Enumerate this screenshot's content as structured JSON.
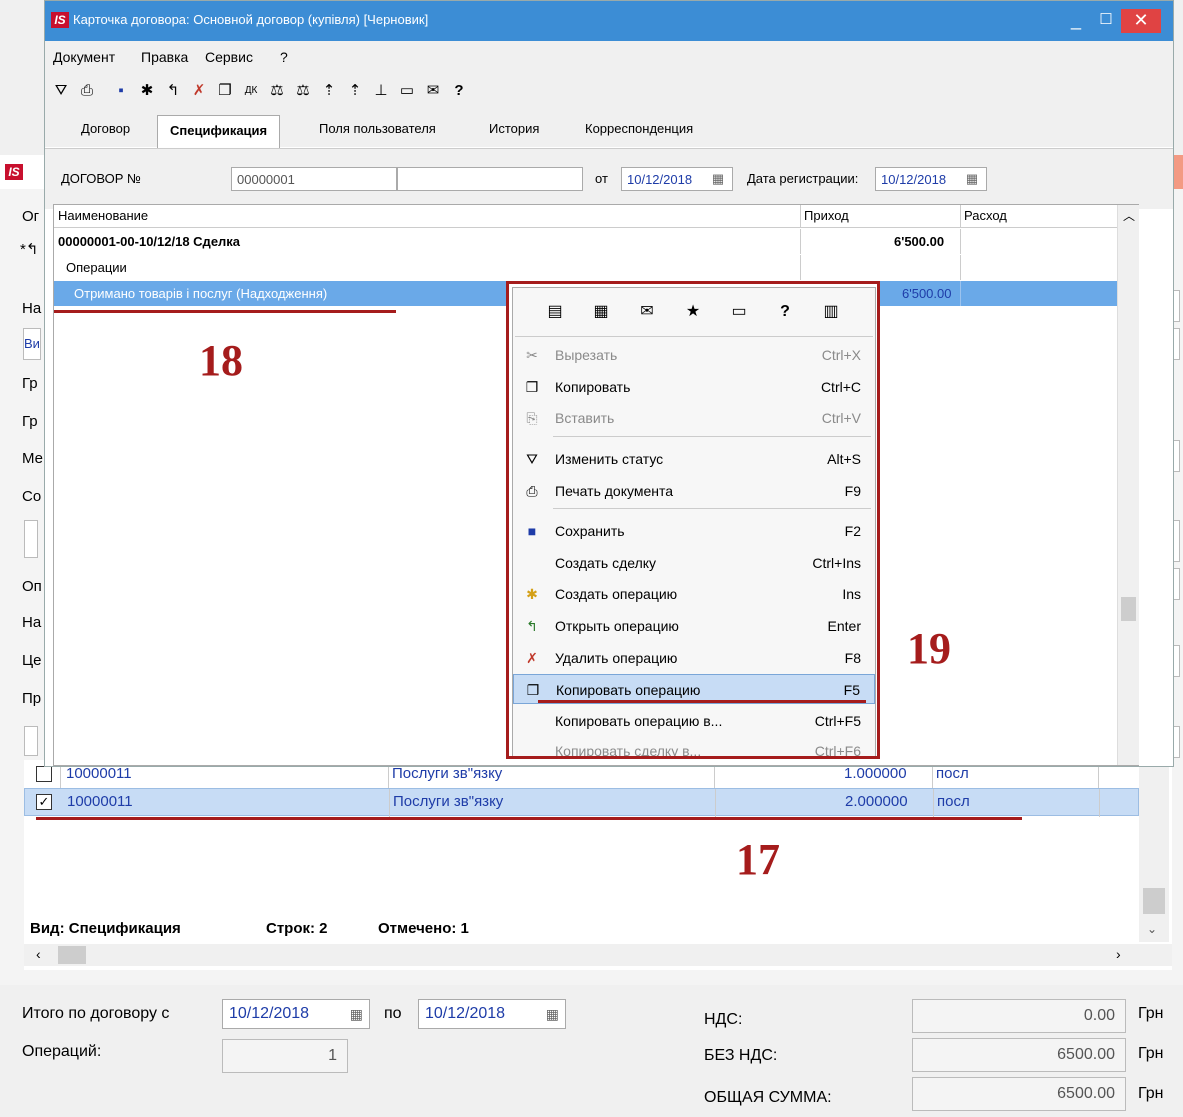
{
  "window": {
    "title": "Карточка договора: Основной договор (купівля) [Черновик]",
    "logo": "IS"
  },
  "menu": [
    "Документ",
    "Правка",
    "Сервис",
    "?"
  ],
  "tabs": [
    "Договор",
    "Спецификация",
    "Поля пользователя",
    "История",
    "Корреспонденция"
  ],
  "form": {
    "contract_label": "ДОГОВОР №",
    "contract_number": "00000001",
    "from_label": "от",
    "from_date": "10/12/2018",
    "reg_label": "Дата регистрации:",
    "reg_date": "10/12/2018"
  },
  "grid": {
    "headers": [
      "Наименование",
      "Приход",
      "Расход"
    ],
    "deal": {
      "name": "00000001-00-10/12/18 Сделка",
      "income": "6'500.00"
    },
    "group": "Операции",
    "operation": {
      "name": "Отримано товарів і послуг (Надходження)",
      "income": "6'500.00"
    }
  },
  "context_menu": {
    "icons": [
      "calculator-icon",
      "calendar-icon",
      "mail-icon",
      "star-icon",
      "document-icon",
      "help-icon",
      "columns-icon"
    ],
    "items": [
      {
        "label": "Вырезать",
        "shortcut": "Ctrl+X",
        "disabled": true
      },
      {
        "label": "Копировать",
        "shortcut": "Ctrl+C"
      },
      {
        "label": "Вставить",
        "shortcut": "Ctrl+V",
        "disabled": true
      },
      {
        "label": "Изменить статус",
        "shortcut": "Alt+S"
      },
      {
        "label": "Печать документа",
        "shortcut": "F9"
      },
      {
        "label": "Сохранить",
        "shortcut": "F2"
      },
      {
        "label": "Создать сделку",
        "shortcut": "Ctrl+Ins"
      },
      {
        "label": "Создать операцию",
        "shortcut": "Ins"
      },
      {
        "label": "Открыть операцию",
        "shortcut": "Enter"
      },
      {
        "label": "Удалить операцию",
        "shortcut": "F8"
      },
      {
        "label": "Копировать операцию",
        "shortcut": "F5",
        "highlighted": true
      },
      {
        "label": "Копировать операцию в...",
        "shortcut": "Ctrl+F5"
      },
      {
        "label": "Копировать сделку в...",
        "shortcut": "Ctrl+F6",
        "disabled": true
      }
    ]
  },
  "annotations": {
    "a17": "17",
    "a18": "18",
    "a19": "19"
  },
  "background_labels": [
    "Ог",
    "На",
    "Ви",
    "Гр",
    "Гр",
    "Ме",
    "Со",
    "Оп",
    "На",
    "Це",
    "Пр"
  ],
  "lower_table": {
    "rows": [
      {
        "checked": false,
        "code": "10000011",
        "name": "Послуги зв\"язку",
        "qty": "1.000000",
        "unit": "посл"
      },
      {
        "checked": true,
        "code": "10000011",
        "name": "Послуги зв\"язку",
        "qty": "2.000000",
        "unit": "посл"
      }
    ],
    "status": {
      "view": "Вид: Спецификация",
      "rows": "Строк: 2",
      "marked": "Отмечено: 1"
    }
  },
  "footer": {
    "total_label": "Итого по договору с",
    "date_from": "10/12/2018",
    "to_label": "по",
    "date_to": "10/12/2018",
    "ops_label": "Операций:",
    "ops_count": "1",
    "vat_label": "НДС:",
    "vat_value": "0.00",
    "novat_label": "БЕЗ НДС:",
    "novat_value": "6500.00",
    "total_sum_label": "ОБЩАЯ СУММА:",
    "total_sum_value": "6500.00",
    "currency": "Грн"
  },
  "colors": {
    "titlebar": "#3c8dd5",
    "annotation": "#a51c1c",
    "selection": "#c7dcf5"
  }
}
